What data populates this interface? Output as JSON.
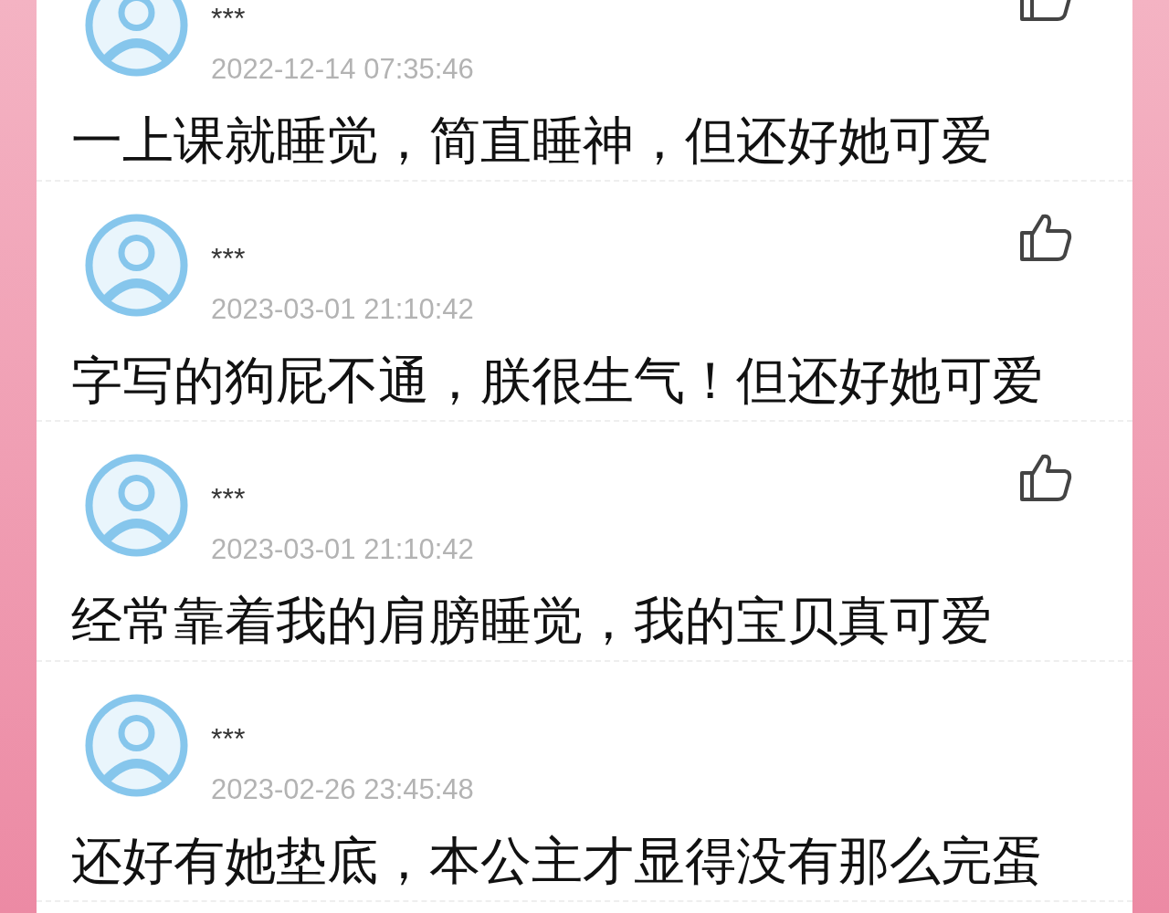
{
  "comments": [
    {
      "name": "***",
      "time": "2022-12-14 07:35:46",
      "text": "一上课就睡觉，简直睡神，但还好她可爱",
      "like_button": true
    },
    {
      "name": "***",
      "time": "2023-03-01 21:10:42",
      "text": "字写的狗屁不通，朕很生气！但还好她可爱",
      "like_button": true
    },
    {
      "name": "***",
      "time": "2023-03-01 21:10:42",
      "text": "经常靠着我的肩膀睡觉，我的宝贝真可爱",
      "like_button": true
    },
    {
      "name": "***",
      "time": "2023-02-26 23:45:48",
      "text": "还好有她垫底，本公主才显得没有那么完蛋",
      "like_button": false
    }
  ]
}
